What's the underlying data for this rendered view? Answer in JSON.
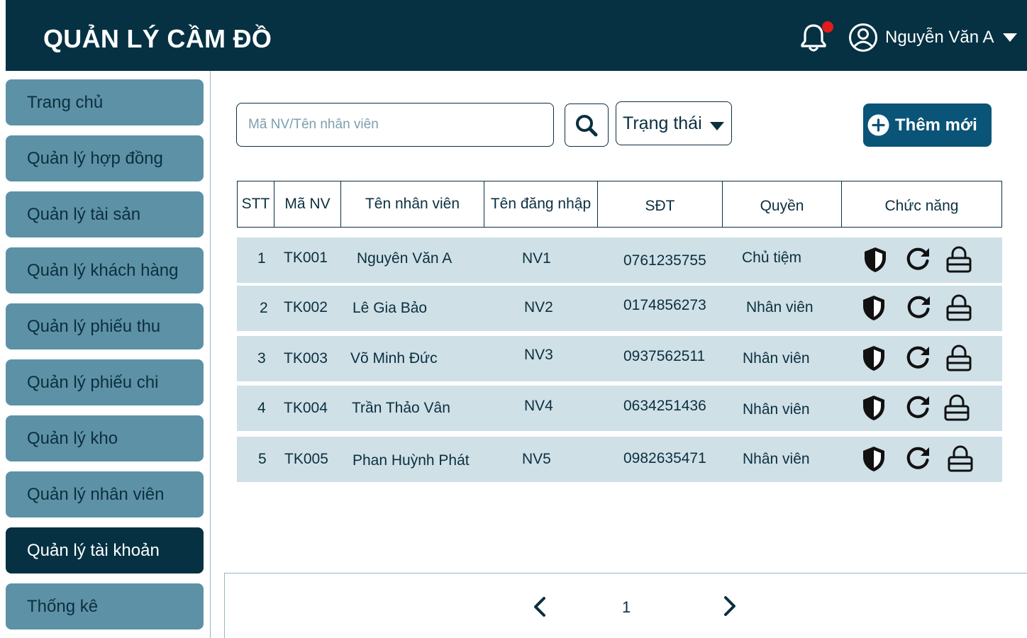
{
  "app": {
    "title": "QUẢN LÝ CẦM ĐỒ"
  },
  "header": {
    "user_name": "Nguyễn Văn A",
    "notification_dot_color": "#e21b1b"
  },
  "sidebar": {
    "items": [
      {
        "label": "Trang chủ",
        "active": false
      },
      {
        "label": "Quản lý hợp đồng",
        "active": false
      },
      {
        "label": "Quản lý tài sản",
        "active": false
      },
      {
        "label": "Quản lý khách hàng",
        "active": false
      },
      {
        "label": "Quản lý phiếu thu",
        "active": false
      },
      {
        "label": "Quản lý phiếu chi",
        "active": false
      },
      {
        "label": "Quản lý kho",
        "active": false
      },
      {
        "label": "Quản lý nhân viên",
        "active": false
      },
      {
        "label": "Quản lý tài khoản",
        "active": true
      },
      {
        "label": "Thống kê",
        "active": false
      }
    ]
  },
  "toolbar": {
    "search_placeholder": "Mã NV/Tên nhân viên",
    "search_value": "",
    "status_label": "Trạng thái",
    "add_label": "Thêm mới"
  },
  "table": {
    "columns": [
      "STT",
      "Mã NV",
      "Tên nhân viên",
      "Tên đăng nhập",
      "SĐT",
      "Quyền",
      "Chức năng"
    ],
    "rows": [
      {
        "stt": "1",
        "code": "TK001",
        "name": "Nguyên Văn A",
        "username": "NV1",
        "phone": "0761235755",
        "role": "Chủ tiệm"
      },
      {
        "stt": "2",
        "code": "TK002",
        "name": "Lê Gia Bảo",
        "username": "NV2",
        "phone": "0174856273",
        "role": "Nhân viên"
      },
      {
        "stt": "3",
        "code": "TK003",
        "name": "Võ Minh Đức",
        "username": "NV3",
        "phone": "0937562511",
        "role": "Nhân viên"
      },
      {
        "stt": "4",
        "code": "TK004",
        "name": "Trần Thảo Vân",
        "username": "NV4",
        "phone": "0634251436",
        "role": "Nhân viên"
      },
      {
        "stt": "5",
        "code": "TK005",
        "name": "Phan Huỳnh Phát",
        "username": "NV5",
        "phone": "0982635471",
        "role": "Nhân viên"
      }
    ],
    "row_actions": [
      "shield-icon",
      "refresh-icon",
      "lock-icon"
    ]
  },
  "pagination": {
    "current_page": "1"
  },
  "colors": {
    "primary": "#053143",
    "sidebar_item": "#5d91a6",
    "row_bg": "#cfe0e7",
    "add_button": "#0a5478"
  }
}
